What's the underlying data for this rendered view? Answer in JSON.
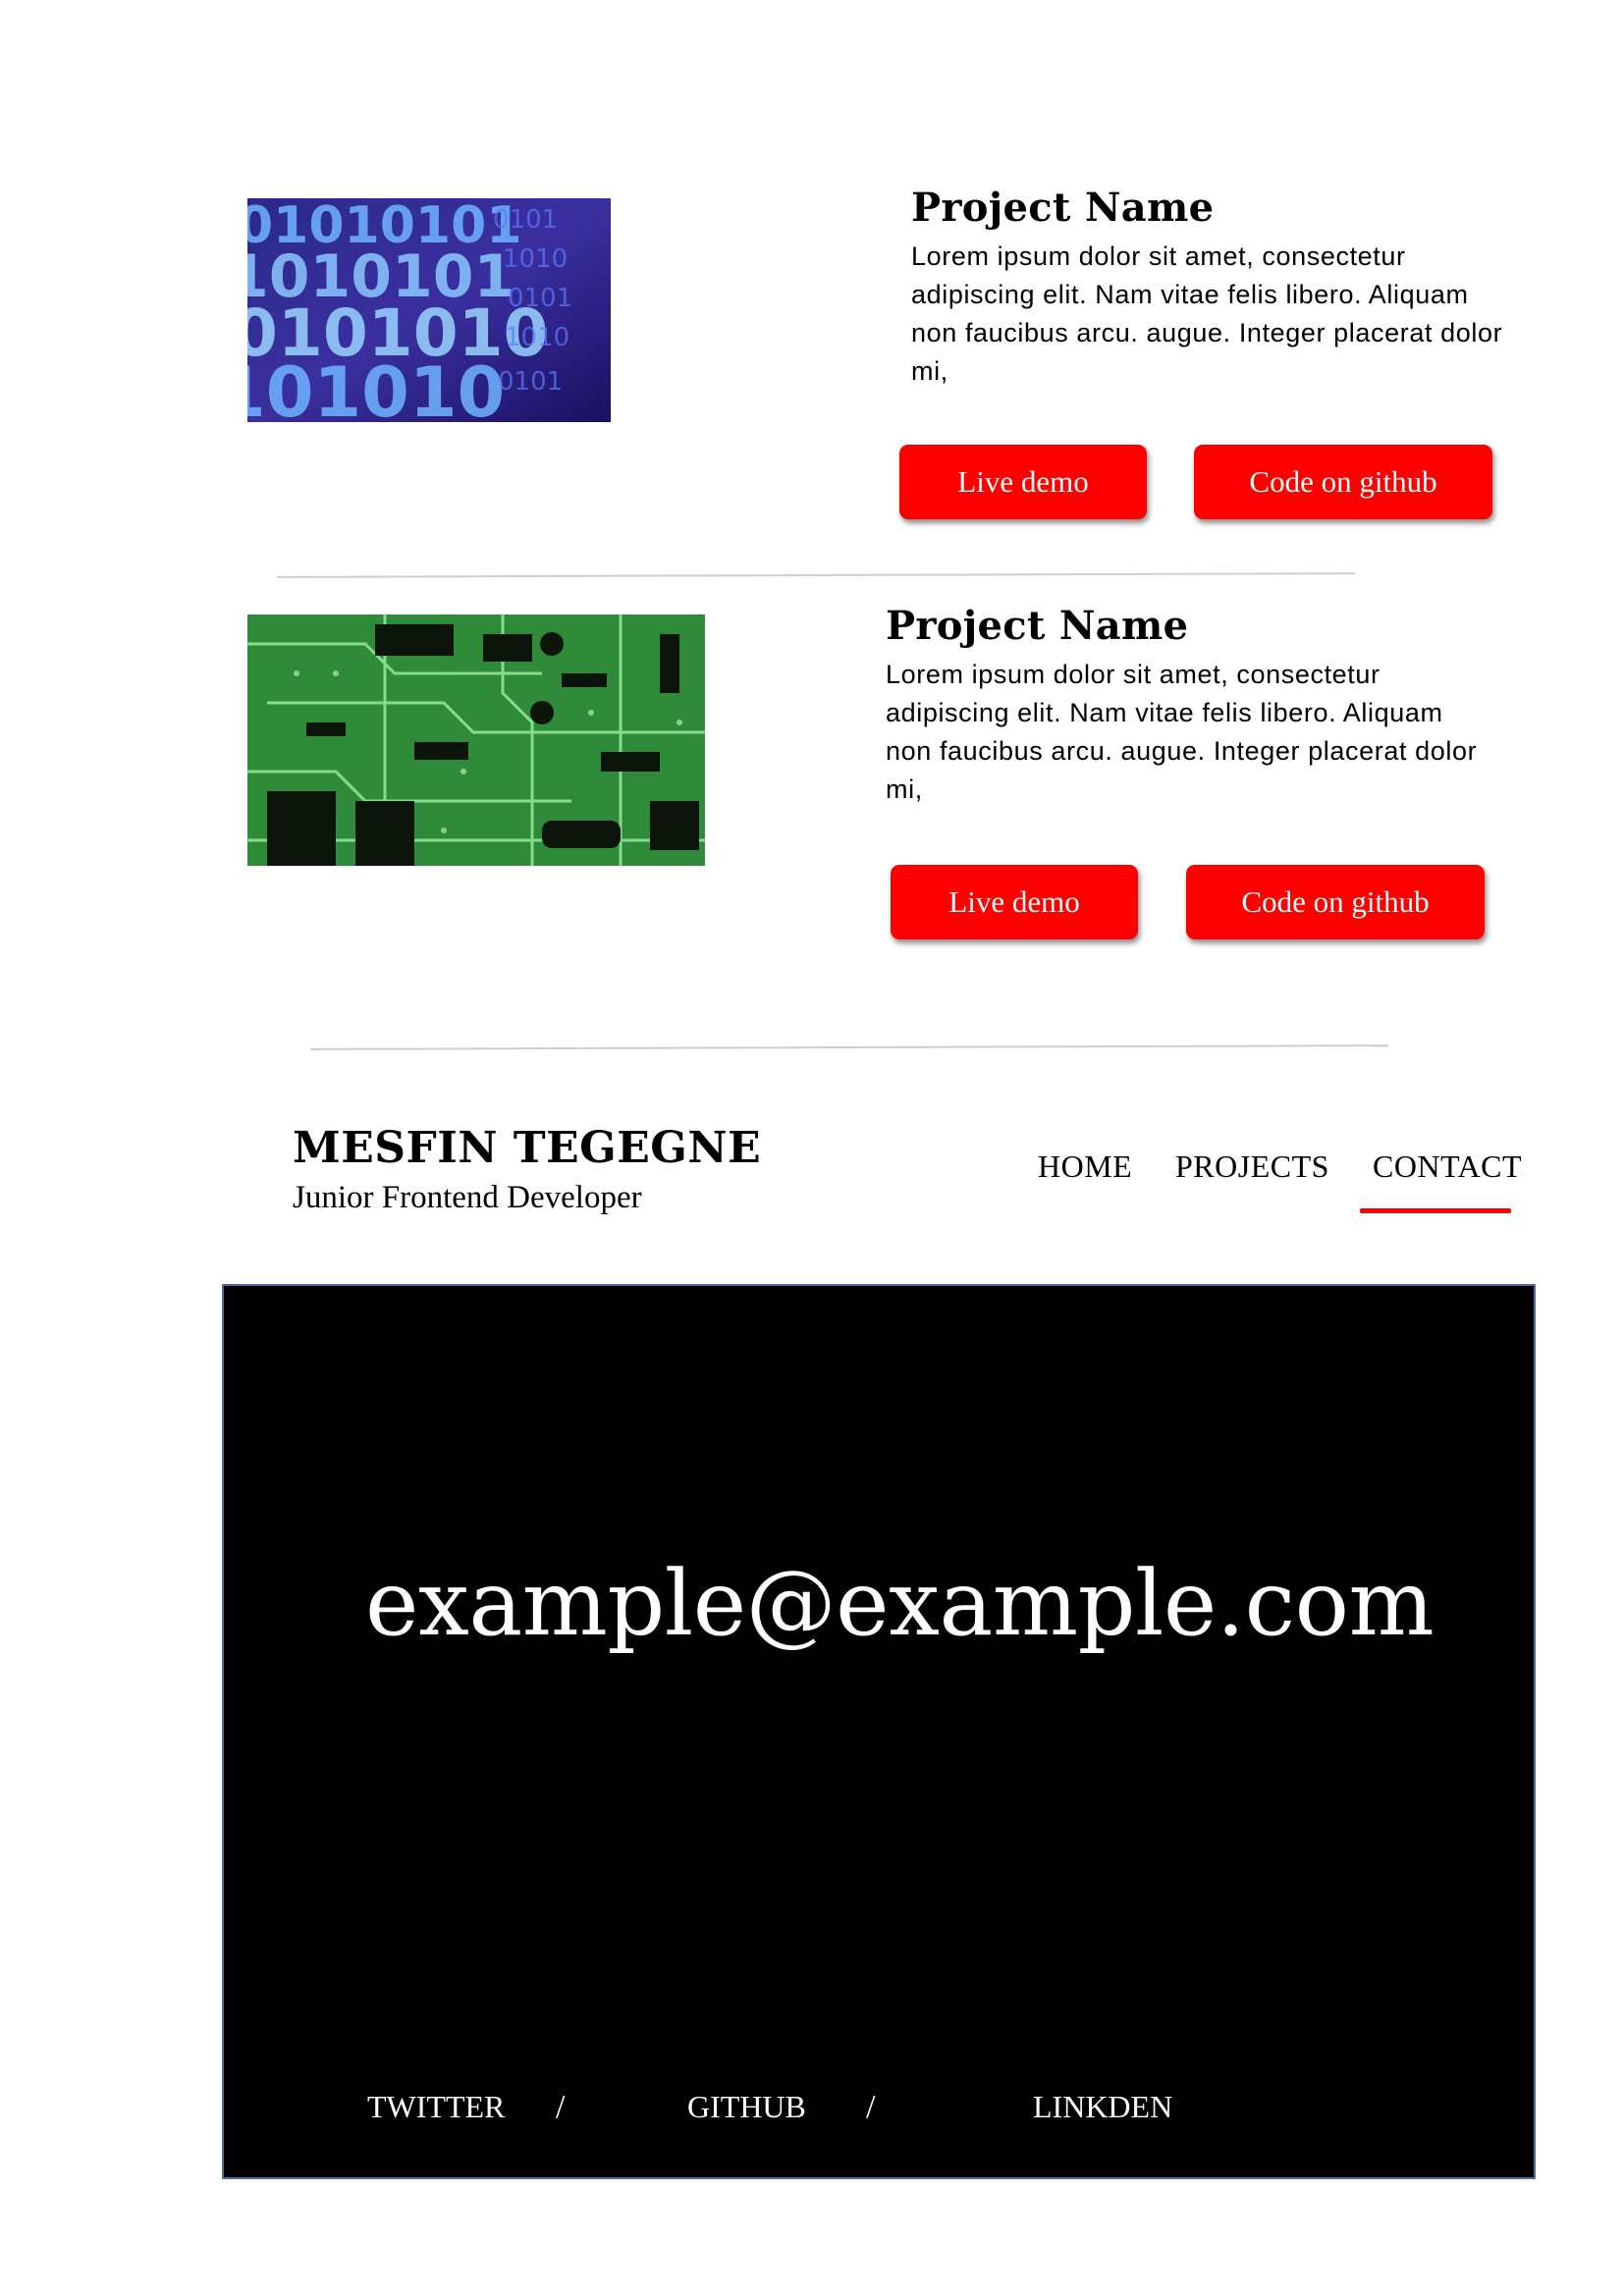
{
  "projects": [
    {
      "image": "binary-code-image",
      "title": "Project Name",
      "description": "Lorem ipsum dolor sit amet, consectetur adipiscing elit. Nam vitae felis libero. Aliquam non faucibus arcu. augue. Integer placerat dolor mi,",
      "live_demo_label": "Live demo",
      "github_label": "Code on github"
    },
    {
      "image": "circuit-board-image",
      "title": "Project Name",
      "description": "Lorem ipsum dolor sit amet, consectetur adipiscing elit. Nam vitae felis libero. Aliquam non faucibus arcu. augue. Integer placerat dolor mi,",
      "live_demo_label": "Live demo",
      "github_label": "Code on github"
    }
  ],
  "header": {
    "name": "MESFIN TEGEGNE",
    "subtitle": "Junior Frontend Developer",
    "nav": [
      "HOME",
      "PROJECTS",
      "CONTACT"
    ],
    "active_nav": "CONTACT"
  },
  "contact": {
    "email": "example@example.com",
    "social": [
      "TWITTER",
      "GITHUB",
      "LINKDEN"
    ],
    "separator": "/"
  },
  "colors": {
    "accent": "#fe0000",
    "contact_background": "#000000",
    "contact_border": "#4a6fa8"
  }
}
